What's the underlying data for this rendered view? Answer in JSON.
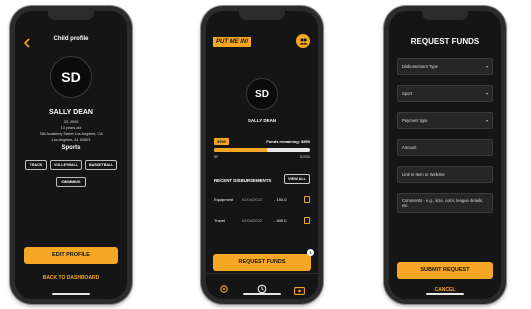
{
  "phone1": {
    "title": "Child profile",
    "back_icon": "chevron-left-icon",
    "initials": "SD",
    "name": "SALLY DEAN",
    "dob": "3/1 2009",
    "age": "13 years old",
    "address1": "766 Academy Street Los Angeles, CA",
    "address2": "Los Angeles, AL 90803",
    "sports_heading": "Sports",
    "sports": [
      "TRACK",
      "VOLLEYBALL",
      "BASKETBALL",
      "SWIMMING"
    ],
    "edit_button": "EDIT PROFILE",
    "back_link": "BACK TO DASHBOARD"
  },
  "phone2": {
    "logo": "PUT ME IN!",
    "initials": "SD",
    "name": "SALLY DEAN",
    "budget": "$550",
    "remaining_label": "Funds remaining: $950",
    "scale_min": "$0",
    "scale_max": "$1000",
    "progress_fraction": 0.55,
    "recent_heading": "RECENT DISBURSEMENTS",
    "view_all": "VIEW ALL",
    "rows": [
      {
        "category": "Equipment",
        "date": "02/04/2022",
        "amount": "- 150.0"
      },
      {
        "category": "Travel",
        "date": "02/04/2022",
        "amount": "- 400.0"
      }
    ],
    "request_button": "REQUEST FUNDS",
    "badge_count": "1",
    "nav_icons": [
      "settings-icon",
      "history-icon",
      "money-icon"
    ]
  },
  "phone3": {
    "title": "REQUEST FUNDS",
    "fields": [
      {
        "label": "Disbursement Type",
        "dropdown": true
      },
      {
        "label": "Sport",
        "dropdown": true
      },
      {
        "label": "Payment type",
        "dropdown": true
      },
      {
        "label": "Amount",
        "dropdown": false
      },
      {
        "label": "Link to Item or Website",
        "dropdown": false
      },
      {
        "label": "Comments - e.g., size, color, league details, etc.",
        "dropdown": false
      }
    ],
    "submit_button": "SUBMIT REQUEST",
    "cancel_link": "CANCEL"
  },
  "colors": {
    "accent": "#f5a623",
    "screen_bg": "#151515",
    "field_bg": "#262626"
  }
}
